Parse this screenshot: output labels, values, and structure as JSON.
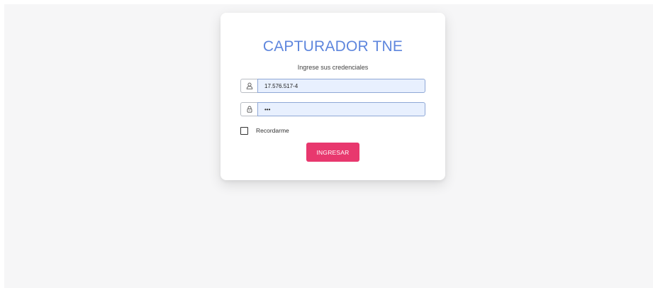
{
  "login": {
    "title": "CAPTURADOR TNE",
    "subtitle": "Ingrese sus credenciales",
    "username": {
      "value": "17.576.517-4",
      "icon": "user-icon"
    },
    "password": {
      "value": "•••",
      "icon": "lock-icon"
    },
    "remember": {
      "label": "Recordarme",
      "checked": false
    },
    "submit_label": "INGRESAR"
  },
  "colors": {
    "title": "#5e86dd",
    "button": "#e8386e",
    "input_autofill_bg": "#e8f0fe",
    "page_bg": "#f6f6f7"
  }
}
